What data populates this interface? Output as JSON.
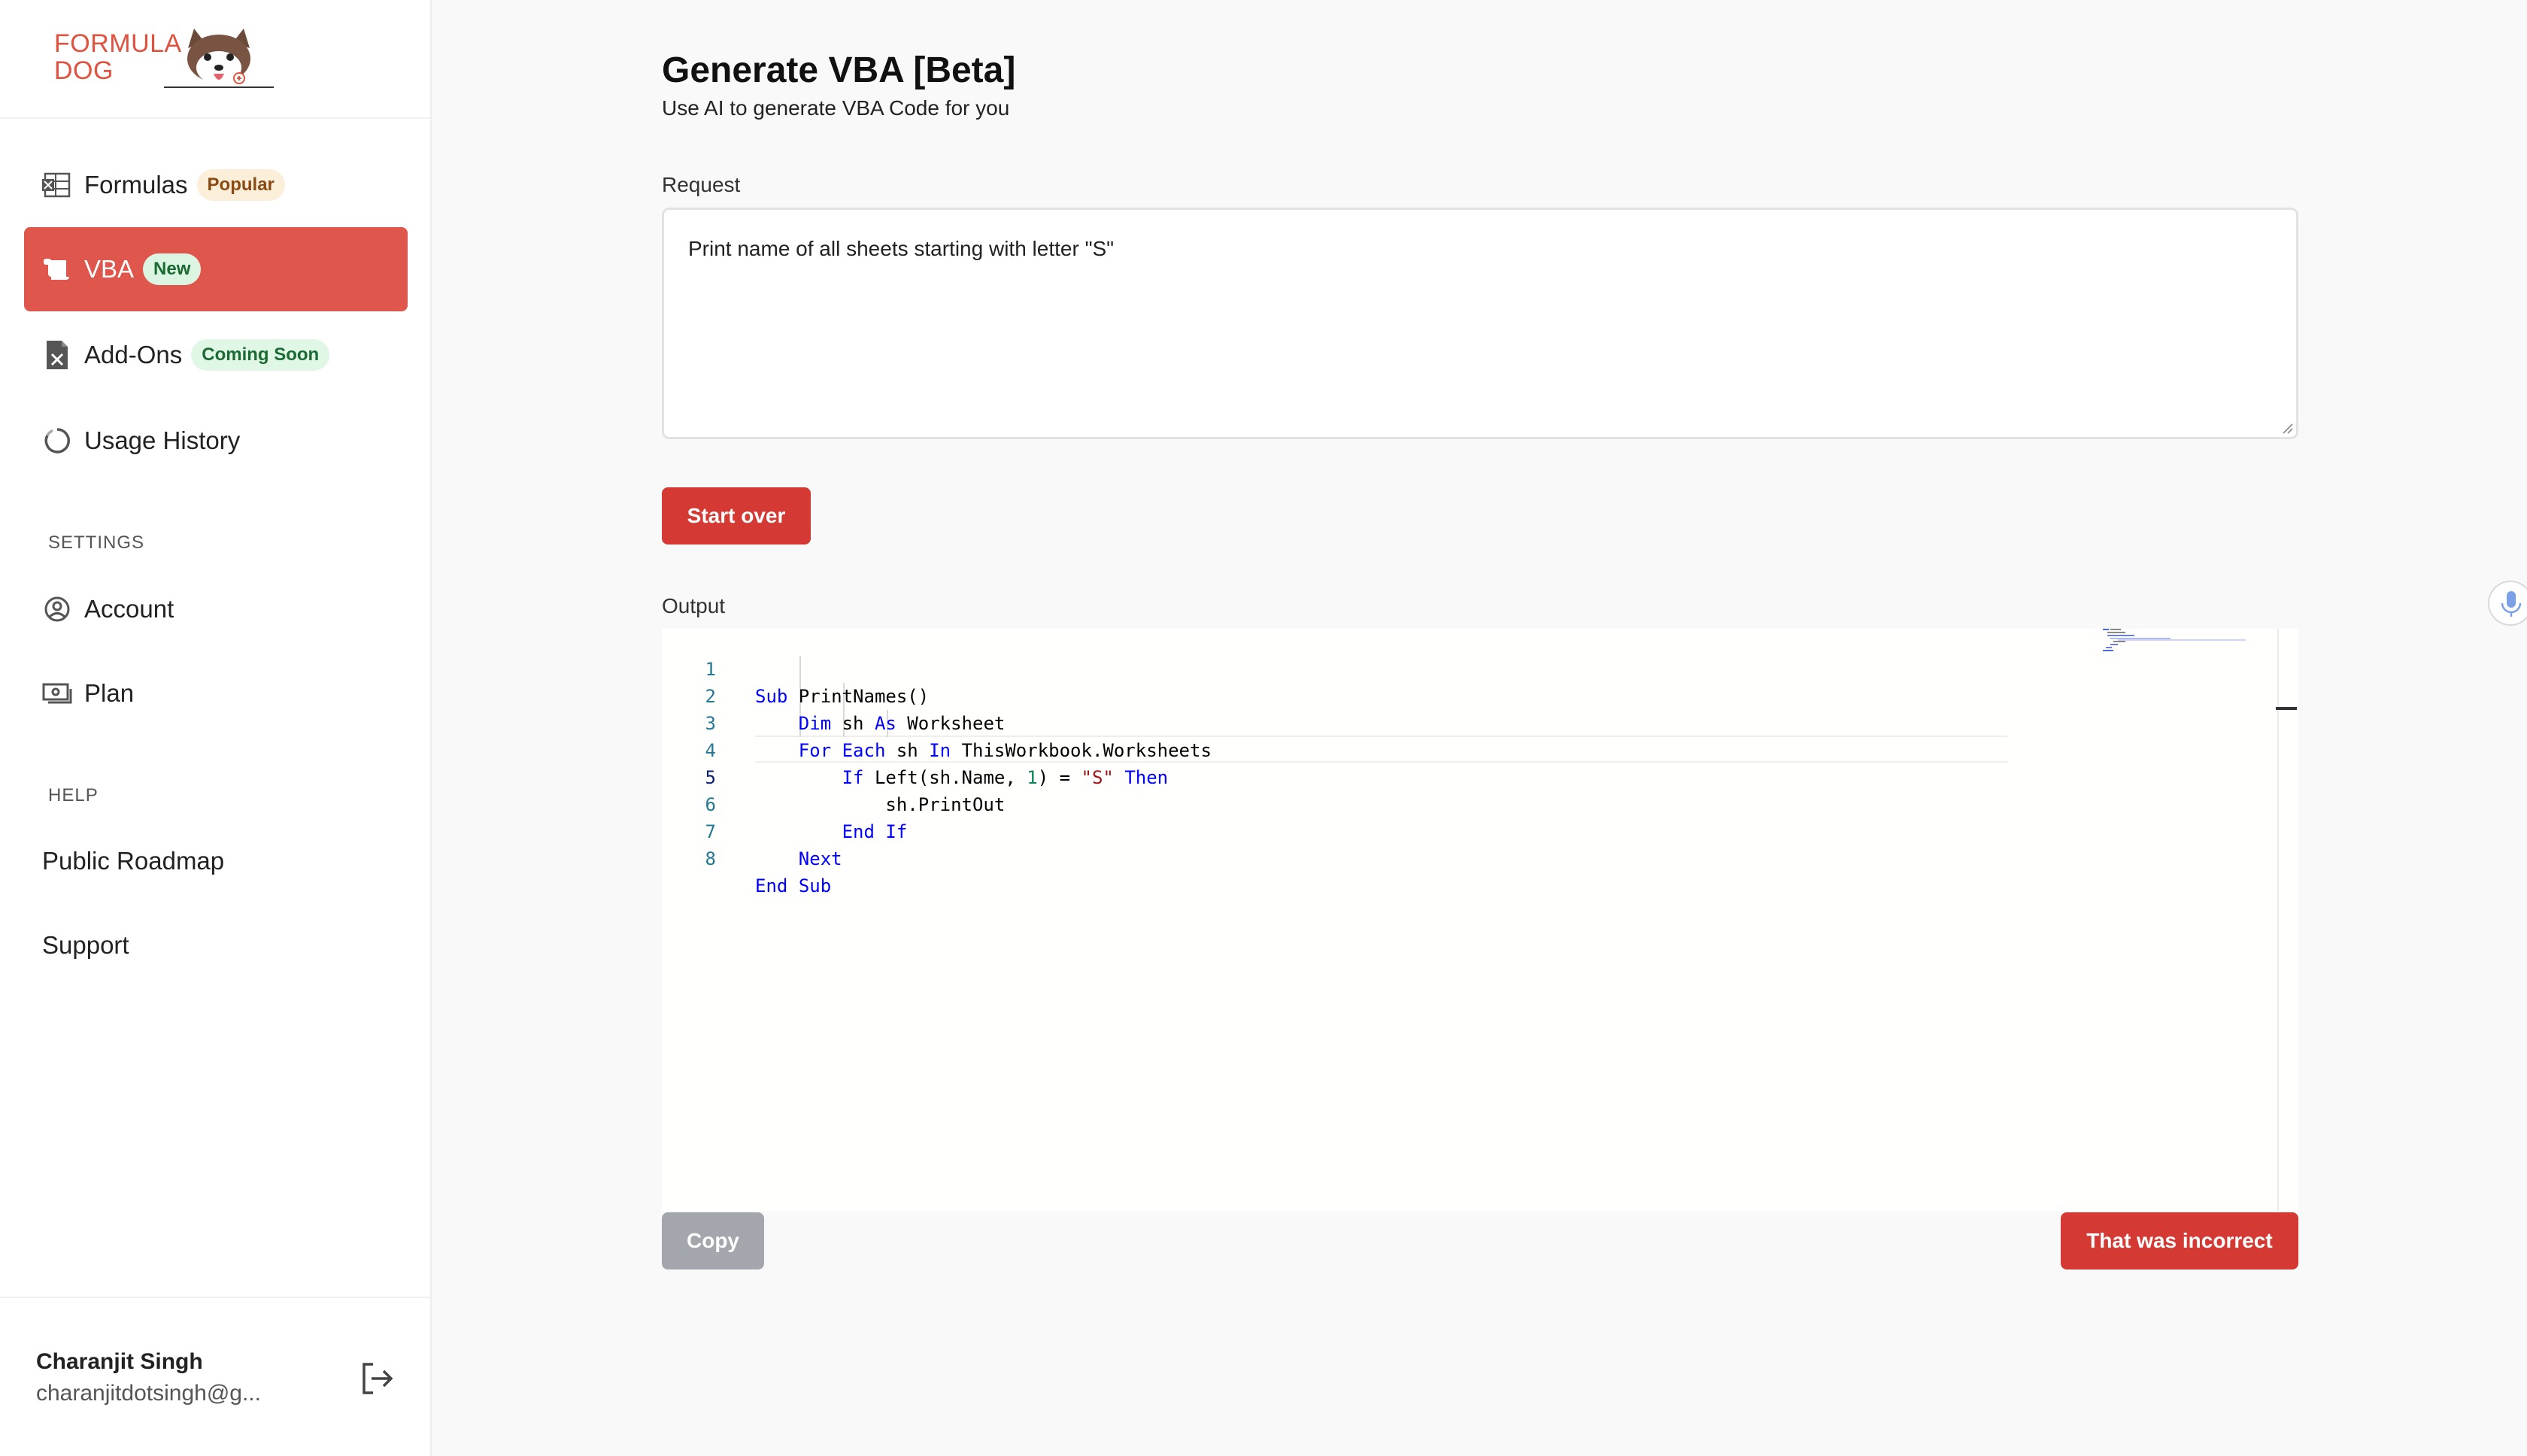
{
  "logo": {
    "text_line1": "FORMULA",
    "text_line2": "DOG"
  },
  "sidebar": {
    "nav": [
      {
        "label": "Formulas",
        "badge": "Popular"
      },
      {
        "label": "VBA",
        "badge": "New"
      },
      {
        "label": "Add-Ons",
        "badge": "Coming Soon"
      },
      {
        "label": "Usage History"
      }
    ],
    "settings_title": "SETTINGS",
    "settings": [
      {
        "label": "Account"
      },
      {
        "label": "Plan"
      }
    ],
    "help_title": "HELP",
    "help": [
      {
        "label": "Public Roadmap"
      },
      {
        "label": "Support"
      }
    ]
  },
  "user": {
    "name": "Charanjit Singh",
    "email": "charanjitdotsingh@g..."
  },
  "page": {
    "title": "Generate VBA [Beta]",
    "subtitle": "Use AI to generate VBA Code for you"
  },
  "request": {
    "label": "Request",
    "value": "Print name of all sheets starting with letter \"S\""
  },
  "buttons": {
    "start_over": "Start over",
    "copy": "Copy",
    "incorrect": "That was incorrect"
  },
  "output": {
    "label": "Output",
    "line_numbers": [
      "1",
      "2",
      "3",
      "4",
      "5",
      "6",
      "7",
      "8"
    ],
    "current_line": 5
  },
  "colors": {
    "accent": "#d43a33",
    "active_nav": "#df564d",
    "keyword": "#0000ff",
    "string": "#a31515",
    "number": "#098658"
  }
}
